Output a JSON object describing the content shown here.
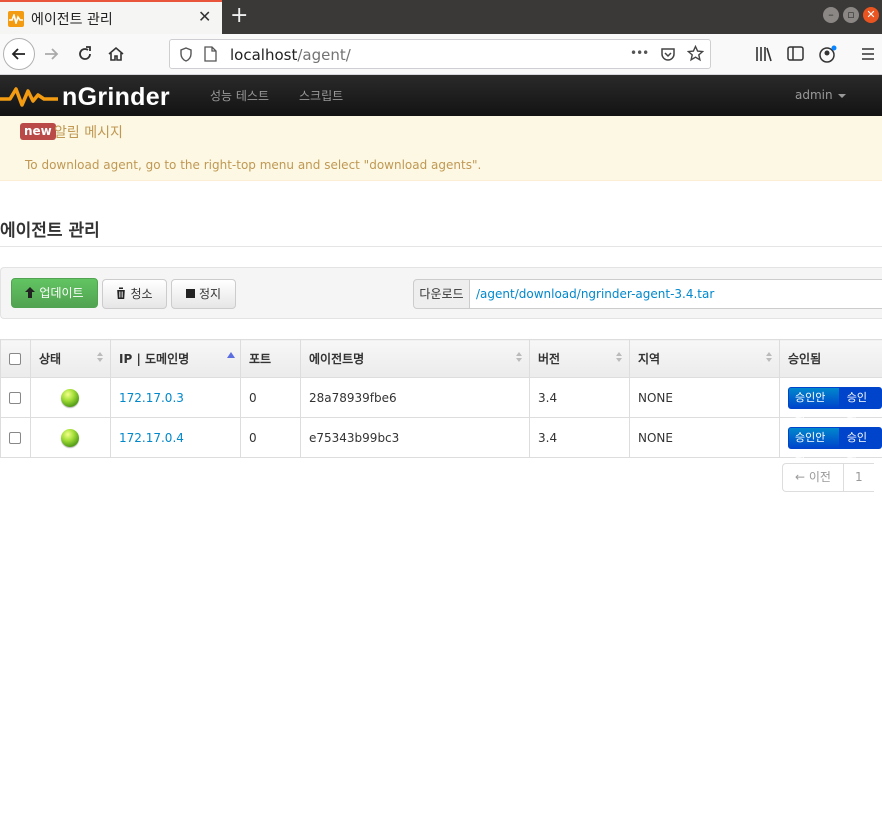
{
  "browser": {
    "tab_title": "에이전트 관리",
    "tab_close": "✕",
    "new_tab": "+",
    "url_host": "localhost",
    "url_path": "/agent/",
    "url_dots": "•••"
  },
  "app": {
    "brand": "nGrinder",
    "nav": [
      {
        "label": "성능 테스트"
      },
      {
        "label": "스크립트"
      }
    ],
    "user": "admin"
  },
  "alert": {
    "badge": "new",
    "title": "알림 메시지",
    "message": "To download agent, go to the right-top menu and select \"download agents\"."
  },
  "page": {
    "title": "에이전트 관리"
  },
  "toolbar": {
    "update": "업데이트",
    "clean": "청소",
    "stop": "정지",
    "download_label": "다운로드",
    "download_link": "/agent/download/ngrinder-agent-3.4.tar"
  },
  "table": {
    "headers": [
      "상태",
      "IP | 도메인명",
      "포트",
      "에이전트명",
      "버전",
      "지역",
      "승인됨"
    ],
    "rows": [
      {
        "ip": "172.17.0.3",
        "port": "0",
        "name": "28a78939fbe6",
        "version": "3.4",
        "region": "NONE",
        "unapprove": "승인안됨",
        "approve": "승인됨"
      },
      {
        "ip": "172.17.0.4",
        "port": "0",
        "name": "e75343b99bc3",
        "version": "3.4",
        "region": "NONE",
        "unapprove": "승인안됨",
        "approve": "승인됨"
      }
    ]
  },
  "pagination": {
    "prev": "← 이전",
    "page": "1"
  },
  "colors": {
    "success": "#51a351",
    "primary": "#0044cc",
    "alert_text": "#c09853",
    "badge": "#b94a48"
  }
}
